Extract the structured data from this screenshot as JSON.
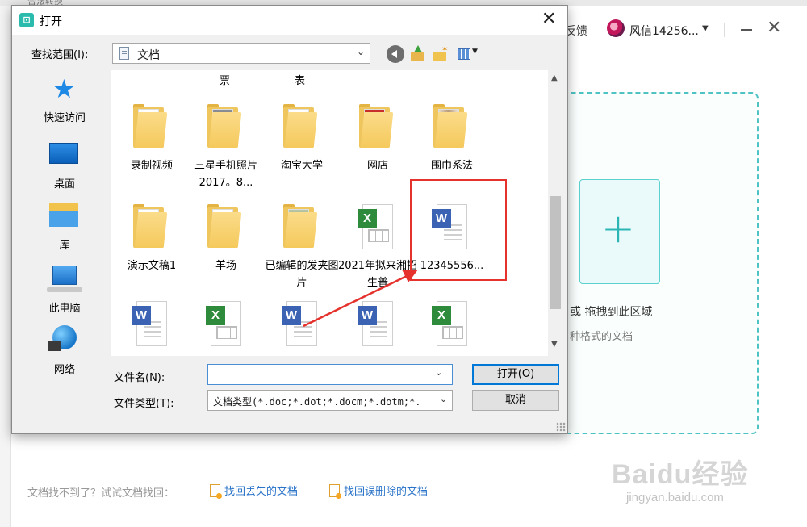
{
  "app": {
    "top_strip_text": "合法转换",
    "feedback_label": "反馈",
    "username": "风信14256...",
    "user_caret": "▼",
    "minimize_label": "",
    "close_glyph": "✕",
    "drop_text": "或 拖拽到此区域",
    "drop_sub": "种格式的文档",
    "plus_glyph": "+",
    "recover_prompt": "文档找不到了？试试文档找回：",
    "recover_link_lost": "找回丢失的文档",
    "recover_link_deleted": "找回误删除的文档",
    "watermark_main": "Baidu经验",
    "watermark_sub": "jingyan.baidu.com",
    "accent_color": "#2bb5b5"
  },
  "dialog": {
    "title": "打开",
    "title_icon_glyph": "⊡",
    "close_glyph": "✕",
    "lookin_label": "查找范围(I):",
    "lookin_value": "文档",
    "lookin_arrow": "⌄",
    "toolbar": {
      "back_icon": "back-icon",
      "up_icon": "up-folder-icon",
      "new_folder_icon": "new-folder-icon",
      "view_menu_icon": "view-menu-icon",
      "view_caret": "▼"
    },
    "places": [
      {
        "label": "快速访问",
        "icon": "star-icon"
      },
      {
        "label": "桌面",
        "icon": "desktop-icon"
      },
      {
        "label": "库",
        "icon": "library-icon"
      },
      {
        "label": "此电脑",
        "icon": "computer-icon"
      },
      {
        "label": "网络",
        "icon": "network-icon"
      }
    ],
    "top_partial_labels": [
      "票",
      "表"
    ],
    "files": [
      {
        "name": "录制视频",
        "type": "folder"
      },
      {
        "name": "三星手机照片2017。8...",
        "type": "folder"
      },
      {
        "name": "淘宝大学",
        "type": "folder"
      },
      {
        "name": "网店",
        "type": "folder"
      },
      {
        "name": "围巾系法",
        "type": "folder"
      },
      {
        "name": "演示文稿1",
        "type": "folder"
      },
      {
        "name": "羊场",
        "type": "folder"
      },
      {
        "name": "已编辑的发夹图片",
        "type": "folder"
      },
      {
        "name": "2021年拟来湘招生普",
        "type": "excel"
      },
      {
        "name": "12345556...",
        "type": "word"
      },
      {
        "name": "",
        "type": "word"
      },
      {
        "name": "",
        "type": "excel"
      },
      {
        "name": "",
        "type": "word"
      },
      {
        "name": "",
        "type": "word"
      },
      {
        "name": "",
        "type": "excel"
      }
    ],
    "badge_word": "W",
    "badge_excel": "X",
    "scroll_up": "▲",
    "scroll_down": "▼",
    "filename_label": "文件名(N):",
    "filename_value": "",
    "filename_drop": "⌄",
    "filetype_label": "文件类型(T):",
    "filetype_value": "文档类型(*.doc;*.dot;*.docm;*.dotm;*.",
    "filetype_drop": "⌄",
    "open_button": "打开(O)",
    "cancel_button": "取消",
    "highlight_color": "#e5322d"
  }
}
